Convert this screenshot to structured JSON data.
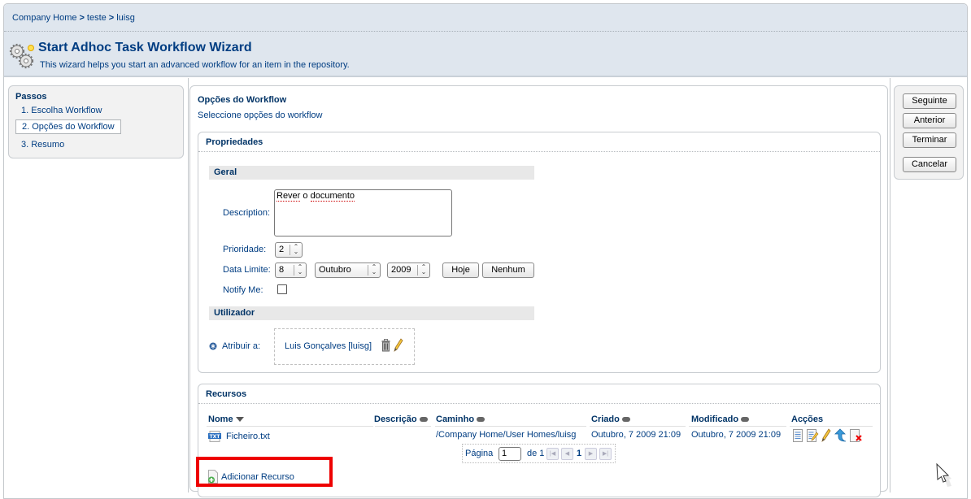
{
  "breadcrumb": {
    "items": [
      "Company Home",
      "teste",
      "luisg"
    ],
    "separator": ">"
  },
  "header": {
    "icon": "gears-icon",
    "title": "Start Adhoc Task Workflow Wizard",
    "description": "This wizard helps you start an advanced workflow for an item in the repository."
  },
  "steps": {
    "title": "Passos",
    "items": [
      {
        "label": "1. Escolha Workflow",
        "active": false
      },
      {
        "label": "2. Opções do Workflow",
        "active": true
      },
      {
        "label": "3. Resumo",
        "active": false
      }
    ]
  },
  "main": {
    "title": "Opções do Workflow",
    "subtitle": "Seleccione opções do workflow"
  },
  "properties": {
    "title": "Propriedades",
    "general_section": "Geral",
    "description_label": "Description:",
    "description_value_words": [
      "Rever",
      "o",
      "documento"
    ],
    "priority_label": "Prioridade:",
    "priority_value": "2",
    "due_date_label": "Data Limite:",
    "due_day": "8",
    "due_month": "Outubro",
    "due_year": "2009",
    "today_button": "Hoje",
    "none_button": "Nenhum",
    "notify_label": "Notify Me:",
    "notify_checked": false,
    "user_section": "Utilizador",
    "assign_label": "Atribuir a:",
    "assignee": "Luis Gonçalves [luisg]"
  },
  "resources": {
    "title": "Recursos",
    "columns": [
      "Nome",
      "Descrição",
      "Caminho",
      "Criado",
      "Modificado",
      "Acções"
    ],
    "rows": [
      {
        "name": "Ficheiro.txt",
        "file_type": "TXT",
        "description": "",
        "path": "/Company Home/User Homes/luisg",
        "created": "Outubro, 7 2009 21:09",
        "modified": "Outubro, 7 2009 21:09",
        "actions": [
          "view-details-icon",
          "edit-properties-icon",
          "edit-icon",
          "update-icon",
          "remove-icon"
        ]
      }
    ],
    "pager": {
      "label": "Página",
      "current": "1",
      "of_label": "de 1",
      "page_number": "1"
    },
    "add_resource": "Adicionar Recurso"
  },
  "actions": {
    "next": "Seguinte",
    "back": "Anterior",
    "finish": "Terminar",
    "cancel": "Cancelar"
  },
  "colors": {
    "header_bg": "#dfe6ee",
    "text_link": "#003d82",
    "highlight": "#ee0000"
  }
}
